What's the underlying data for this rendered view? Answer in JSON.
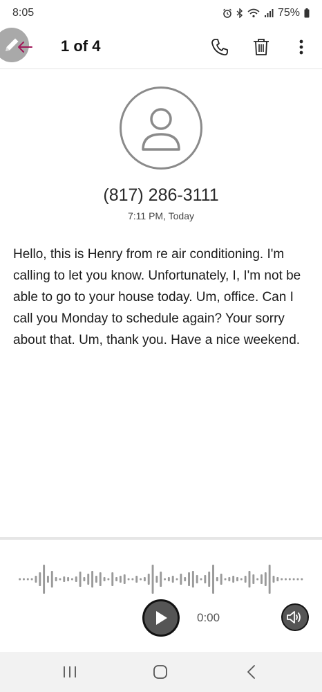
{
  "status_bar": {
    "time": "8:05",
    "battery": "75%",
    "icons": [
      "alarm-icon",
      "bluetooth-icon",
      "wifi-icon",
      "signal-icon",
      "battery-icon"
    ]
  },
  "header": {
    "title": "1 of 4",
    "icons": [
      "edit-icon",
      "back-arrow-icon",
      "phone-icon",
      "trash-icon",
      "more-vert-icon"
    ]
  },
  "contact": {
    "phone_number": "(817) 286-3111",
    "call_time": "7:11 PM, Today"
  },
  "transcript": "Hello, this is Henry from re air conditioning. I'm calling to let you know. Unfortunately, I, I'm not be able to go to your house today. Um, office. Can I call you Monday to schedule again? Your sorry about that. Um, thank you. Have a nice weekend.",
  "player": {
    "time": "0:00",
    "icons": [
      "play-icon",
      "speaker-icon"
    ]
  },
  "nav_bar": {
    "icons": [
      "recents-icon",
      "home-icon",
      "back-icon"
    ]
  },
  "colors": {
    "accent_back": "#a0195a",
    "icon_dark": "#222222",
    "waveform": "#9a9a9a"
  }
}
